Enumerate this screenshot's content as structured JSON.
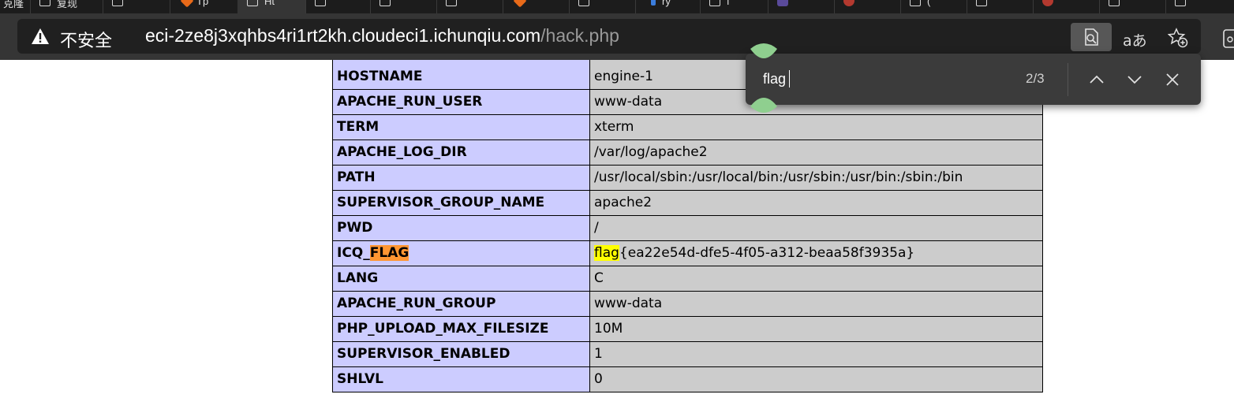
{
  "browser": {
    "tabs": [
      {
        "label": "克隆",
        "icon": "page-icon"
      },
      {
        "label": "复现",
        "icon": "page-icon"
      },
      {
        "label": "",
        "icon": "page-icon"
      },
      {
        "label": "Tp",
        "icon": "brand-orange-icon"
      },
      {
        "label": "Ht",
        "icon": "page-icon"
      },
      {
        "label": "",
        "icon": "page-icon"
      },
      {
        "label": "",
        "icon": "page-icon"
      },
      {
        "label": "",
        "icon": "page-icon"
      },
      {
        "label": "",
        "icon": "page-icon"
      },
      {
        "label": "",
        "icon": "brand-orange-icon"
      },
      {
        "label": "",
        "icon": "page-icon"
      },
      {
        "label": "ry",
        "icon": "blue-icon"
      },
      {
        "label": "f",
        "icon": "page-icon"
      },
      {
        "label": "",
        "icon": "purple-icon"
      },
      {
        "label": "",
        "icon": "red-icon"
      },
      {
        "label": "(",
        "icon": "page-icon"
      },
      {
        "label": "",
        "icon": "page-icon"
      },
      {
        "label": "",
        "icon": "page-icon"
      },
      {
        "label": "",
        "icon": "red-icon"
      },
      {
        "label": "",
        "icon": "page-icon"
      },
      {
        "label": "",
        "icon": "page-icon"
      }
    ],
    "address_bar": {
      "security_label": "不安全",
      "url_host": "eci-2ze8j3xqhbs4ri1rt2kh.cloudeci1.ichunqiu.com",
      "url_path": "/hack.php"
    },
    "read_aloud_label": "aあ"
  },
  "find_bar": {
    "query": "flag",
    "count": "2/3"
  },
  "env_table": {
    "rows": [
      {
        "name": "HOSTNAME",
        "value": "engine-1"
      },
      {
        "name": "APACHE_RUN_USER",
        "value": "www-data"
      },
      {
        "name": "TERM",
        "value": "xterm"
      },
      {
        "name": "APACHE_LOG_DIR",
        "value": "/var/log/apache2"
      },
      {
        "name": "PATH",
        "value": "/usr/local/sbin:/usr/local/bin:/usr/sbin:/usr/bin:/sbin:/bin"
      },
      {
        "name": "SUPERVISOR_GROUP_NAME",
        "value": "apache2"
      },
      {
        "name": "PWD",
        "value": "/"
      },
      {
        "name": "ICQ_FLAG",
        "name_prefix": "ICQ_",
        "name_match": "FLAG",
        "value_match": "flag",
        "value_rest": "{ea22e54d-dfe5-4f05-a312-beaa58f3935a}"
      },
      {
        "name": "LANG",
        "value": "C"
      },
      {
        "name": "APACHE_RUN_GROUP",
        "value": "www-data"
      },
      {
        "name": "PHP_UPLOAD_MAX_FILESIZE",
        "value": "10M"
      },
      {
        "name": "SUPERVISOR_ENABLED",
        "value": "1"
      },
      {
        "name": "SHLVL",
        "value": "0"
      }
    ]
  },
  "colors": {
    "row_label_bg": "#ccccff",
    "row_value_bg": "#cccccc",
    "current_match": "#ff9632",
    "other_match": "#ffff00",
    "handle_green": "#8fcf8f"
  }
}
